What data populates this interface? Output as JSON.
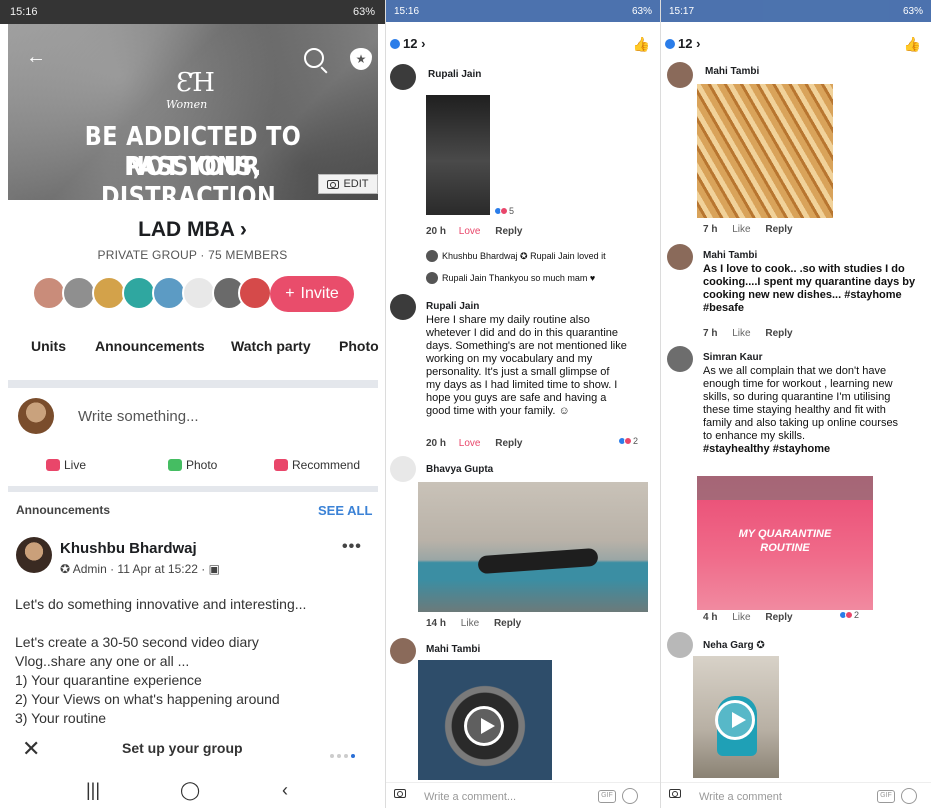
{
  "panel1": {
    "status": {
      "time": "15:16",
      "battery": "63%"
    },
    "cover": {
      "logo_mark": "ƐꞪ",
      "logo_sub": "Women",
      "line1": "BE ADDICTED TO PASSIONS,",
      "line2": "NOT YOUR DISTRACTION.",
      "edit_label": "EDIT"
    },
    "group": {
      "name": "LAD MBA ›",
      "meta": "PRIVATE GROUP · 75 MEMBERS",
      "invite_label": "Invite"
    },
    "tabs": [
      "Units",
      "Announcements",
      "Watch party",
      "Photo"
    ],
    "composer": {
      "placeholder": "Write something..."
    },
    "actions": {
      "live": "Live",
      "photo": "Photo",
      "recommend": "Recommend"
    },
    "announcements": {
      "label": "Announcements",
      "see_all": "SEE ALL"
    },
    "post": {
      "author": "Khushbu Bhardwaj",
      "meta": "Admin · 11 Apr at 15:22 ·",
      "more": "•••",
      "lines": [
        "Let's do something innovative and interesting...",
        "",
        "Let's create a 30-50 second video diary",
        "Vlog..share any one or all ...",
        "1) Your quarantine experience",
        "2) Your Views on what's happening around",
        "3) Your routine"
      ]
    },
    "setup_bar": {
      "label": "Set up your group"
    },
    "colors": {
      "invite": "#e94d6b",
      "link": "#3b82d6"
    }
  },
  "panel2": {
    "status": {
      "time": "15:16",
      "battery": "63%"
    },
    "count": "12 ›",
    "comments": {
      "c1": {
        "name": "Rupali Jain",
        "time": "20 h",
        "love": "Love",
        "reply": "Reply",
        "reacts": "5"
      },
      "r1": {
        "text": "Khushbu Bhardwaj ✪ Rupali Jain loved it"
      },
      "r2": {
        "text": "Rupali Jain Thankyou so much mam ♥"
      },
      "c2": {
        "name": "Rupali Jain",
        "lines": [
          "Here I share my daily routine also",
          "whetever I did and do in this quarantine",
          "days. Something's are not mentioned like",
          "working on my vocabulary and my",
          "personality. It's just a small glimpse of",
          "my days as I had limited time to show. I",
          "hope you guys are safe and having a",
          "good time with your family. ☺"
        ],
        "time": "20 h",
        "love": "Love",
        "reply": "Reply",
        "reacts": "2"
      },
      "c3": {
        "name": "Bhavya Gupta",
        "time": "14 h",
        "like": "Like",
        "reply": "Reply"
      },
      "c4": {
        "name": "Mahi Tambi"
      }
    },
    "comment_bar": {
      "placeholder": "Write a comment..."
    }
  },
  "panel3": {
    "status": {
      "time": "15:17",
      "battery": "63%"
    },
    "count": "12 ›",
    "comments": {
      "c1": {
        "name": "Mahi Tambi",
        "time": "7 h",
        "like": "Like",
        "reply": "Reply"
      },
      "c2": {
        "name": "Mahi Tambi",
        "lines": [
          "As I love to cook.. .so with studies I do",
          "cooking....I spent my quarantine days by",
          "cooking new new dishes... #stayhome",
          "#besafe"
        ],
        "time": "7 h",
        "like": "Like",
        "reply": "Reply"
      },
      "c3": {
        "name": "Simran Kaur",
        "lines": [
          "As we all complain that we don't have",
          "enough time for workout , learning new",
          "skills, so during quarantine I'm utilising",
          "these time staying healthy and fit with",
          "family and also taking up online courses",
          "to enhance my skills.",
          "#stayhealthy #stayhome"
        ],
        "image_caption_1": "MY QUARANTINE",
        "image_caption_2": "ROUTINE",
        "time": "4 h",
        "like": "Like",
        "reply": "Reply",
        "reacts": "2"
      },
      "c4": {
        "name": "Neha Garg ✪"
      }
    },
    "comment_bar": {
      "placeholder": "Write a comment"
    }
  }
}
